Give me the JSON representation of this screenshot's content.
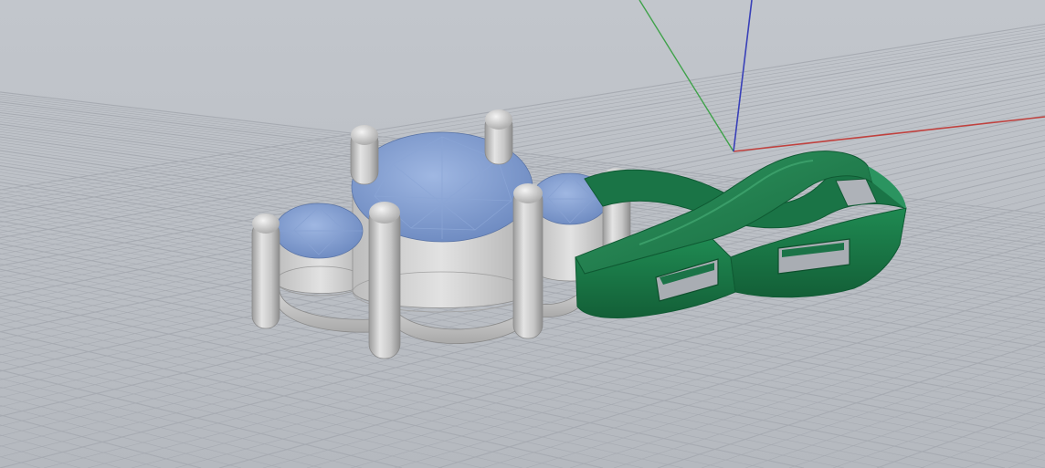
{
  "viewport": {
    "view": "Perspective",
    "background_color": "#b9bdc3",
    "grid": true,
    "grid_color": "#a7abb2",
    "axes": {
      "x_color": "#c0413e",
      "y_color": "#3fa24a",
      "z_color": "#3940b8"
    }
  },
  "objects": [
    {
      "name": "gem-setting",
      "material": "metal",
      "color": "#c9c9c9"
    },
    {
      "name": "gemstones",
      "material": "stone",
      "color": "#7d9bd2",
      "count": 3
    },
    {
      "name": "infinity-band",
      "material": "green",
      "color": "#1f7a4a"
    }
  ]
}
